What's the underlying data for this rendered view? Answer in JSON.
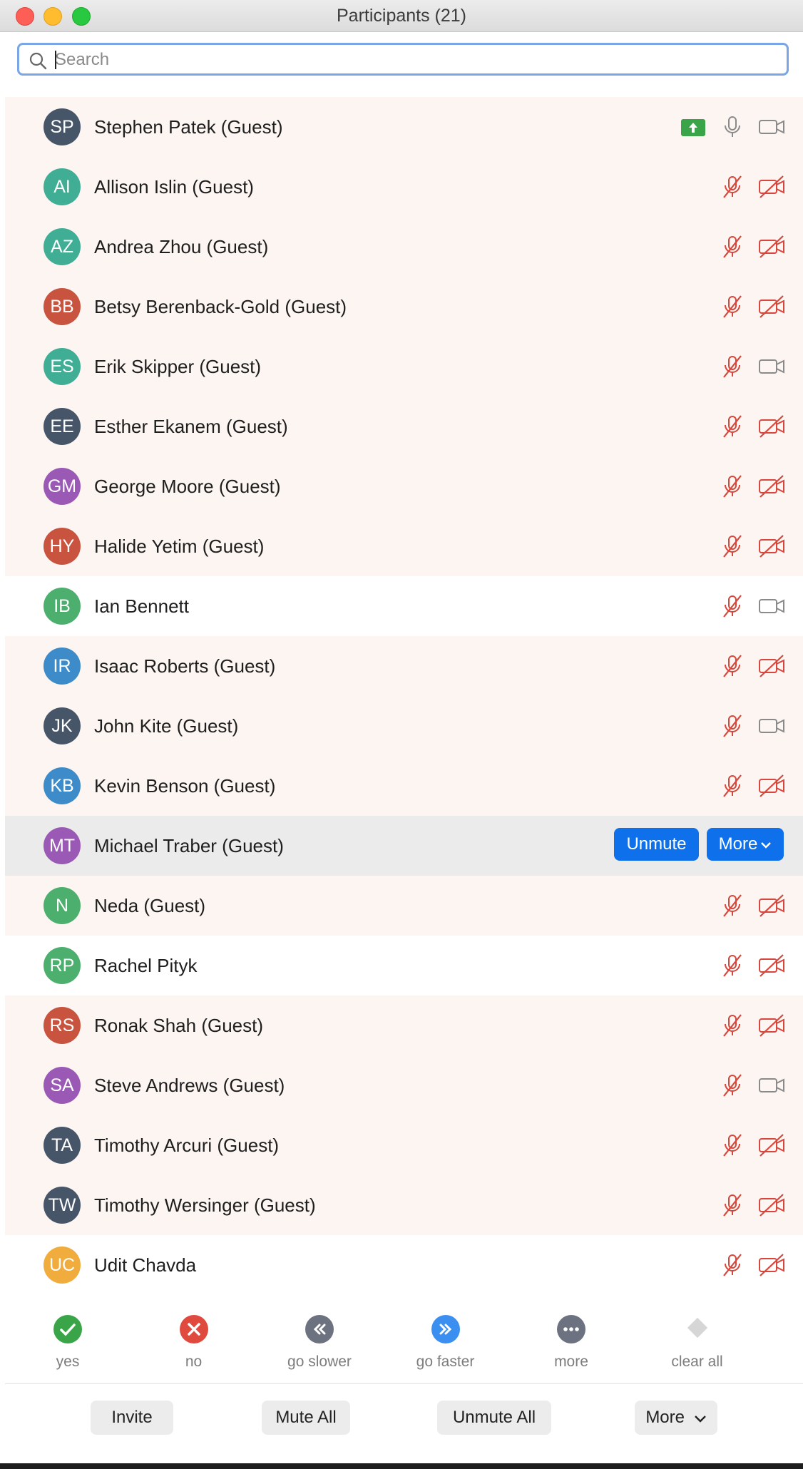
{
  "window": {
    "title": "Participants (21)"
  },
  "search": {
    "placeholder": "Search",
    "value": ""
  },
  "participants": [
    {
      "initials": "SP",
      "name": "Stephen Patek (Guest)",
      "color": "#475569",
      "bg": "guest",
      "mic": "on",
      "cam": "on",
      "sharing": true
    },
    {
      "initials": "AI",
      "name": "Allison Islin (Guest)",
      "color": "#3fae94",
      "bg": "guest",
      "mic": "muted",
      "cam": "off"
    },
    {
      "initials": "AZ",
      "name": "Andrea Zhou (Guest)",
      "color": "#3fae94",
      "bg": "guest",
      "mic": "muted",
      "cam": "off"
    },
    {
      "initials": "BB",
      "name": "Betsy Berenback-Gold (Guest)",
      "color": "#c8533e",
      "bg": "guest",
      "mic": "muted",
      "cam": "off"
    },
    {
      "initials": "ES",
      "name": "Erik Skipper (Guest)",
      "color": "#3fae94",
      "bg": "guest",
      "mic": "muted",
      "cam": "on"
    },
    {
      "initials": "EE",
      "name": "Esther Ekanem (Guest)",
      "color": "#475569",
      "bg": "guest",
      "mic": "muted",
      "cam": "off"
    },
    {
      "initials": "GM",
      "name": "George Moore (Guest)",
      "color": "#9b59b6",
      "bg": "guest",
      "mic": "muted",
      "cam": "off"
    },
    {
      "initials": "HY",
      "name": "Halide Yetim (Guest)",
      "color": "#c8533e",
      "bg": "guest",
      "mic": "muted",
      "cam": "off"
    },
    {
      "initials": "IB",
      "name": "Ian Bennett",
      "color": "#4caf6e",
      "bg": "host",
      "mic": "muted",
      "cam": "on"
    },
    {
      "initials": "IR",
      "name": "Isaac Roberts (Guest)",
      "color": "#3d8bc9",
      "bg": "guest",
      "mic": "muted",
      "cam": "off"
    },
    {
      "initials": "JK",
      "name": "John Kite (Guest)",
      "color": "#475569",
      "bg": "guest",
      "mic": "muted",
      "cam": "on"
    },
    {
      "initials": "KB",
      "name": "Kevin Benson (Guest)",
      "color": "#3d8bc9",
      "bg": "guest",
      "mic": "muted",
      "cam": "off"
    },
    {
      "initials": "MT",
      "name": "Michael Traber (Guest)",
      "color": "#9b59b6",
      "bg": "hover",
      "mic": "none",
      "cam": "none",
      "buttons": true
    },
    {
      "initials": "N",
      "name": "Neda (Guest)",
      "color": "#4caf6e",
      "bg": "guest",
      "mic": "muted",
      "cam": "off"
    },
    {
      "initials": "RP",
      "name": "Rachel Pityk",
      "color": "#4caf6e",
      "bg": "host",
      "mic": "muted",
      "cam": "off"
    },
    {
      "initials": "RS",
      "name": "Ronak Shah (Guest)",
      "color": "#c8533e",
      "bg": "guest",
      "mic": "muted",
      "cam": "off"
    },
    {
      "initials": "SA",
      "name": "Steve Andrews (Guest)",
      "color": "#9b59b6",
      "bg": "guest",
      "mic": "muted",
      "cam": "on"
    },
    {
      "initials": "TA",
      "name": "Timothy Arcuri (Guest)",
      "color": "#475569",
      "bg": "guest",
      "mic": "muted",
      "cam": "off"
    },
    {
      "initials": "TW",
      "name": "Timothy Wersinger (Guest)",
      "color": "#475569",
      "bg": "guest",
      "mic": "muted",
      "cam": "off"
    },
    {
      "initials": "UC",
      "name": "Udit Chavda",
      "color": "#f0ac3c",
      "bg": "host",
      "mic": "muted",
      "cam": "off"
    }
  ],
  "row_actions": {
    "unmute_label": "Unmute",
    "more_label": "More"
  },
  "reactions": [
    {
      "id": "yes",
      "label": "yes",
      "color": "#3aa548",
      "icon": "check-icon"
    },
    {
      "id": "no",
      "label": "no",
      "color": "#e0493e",
      "icon": "x-icon"
    },
    {
      "id": "go-slower",
      "label": "go slower",
      "color": "#6c7280",
      "icon": "rewind-icon"
    },
    {
      "id": "go-faster",
      "label": "go faster",
      "color": "#3b8ff0",
      "icon": "fast-forward-icon"
    },
    {
      "id": "more",
      "label": "more",
      "color": "#6c7280",
      "icon": "ellipsis-icon"
    },
    {
      "id": "clear-all",
      "label": "clear all",
      "color": "#d6d6d6",
      "icon": "eraser-icon"
    }
  ],
  "footer": {
    "invite": "Invite",
    "mute_all": "Mute All",
    "unmute_all": "Unmute All",
    "more": "More"
  },
  "colors": {
    "muted_red": "#d8463c",
    "icon_gray": "#8a8a8a",
    "accent": "#0e71eb"
  }
}
